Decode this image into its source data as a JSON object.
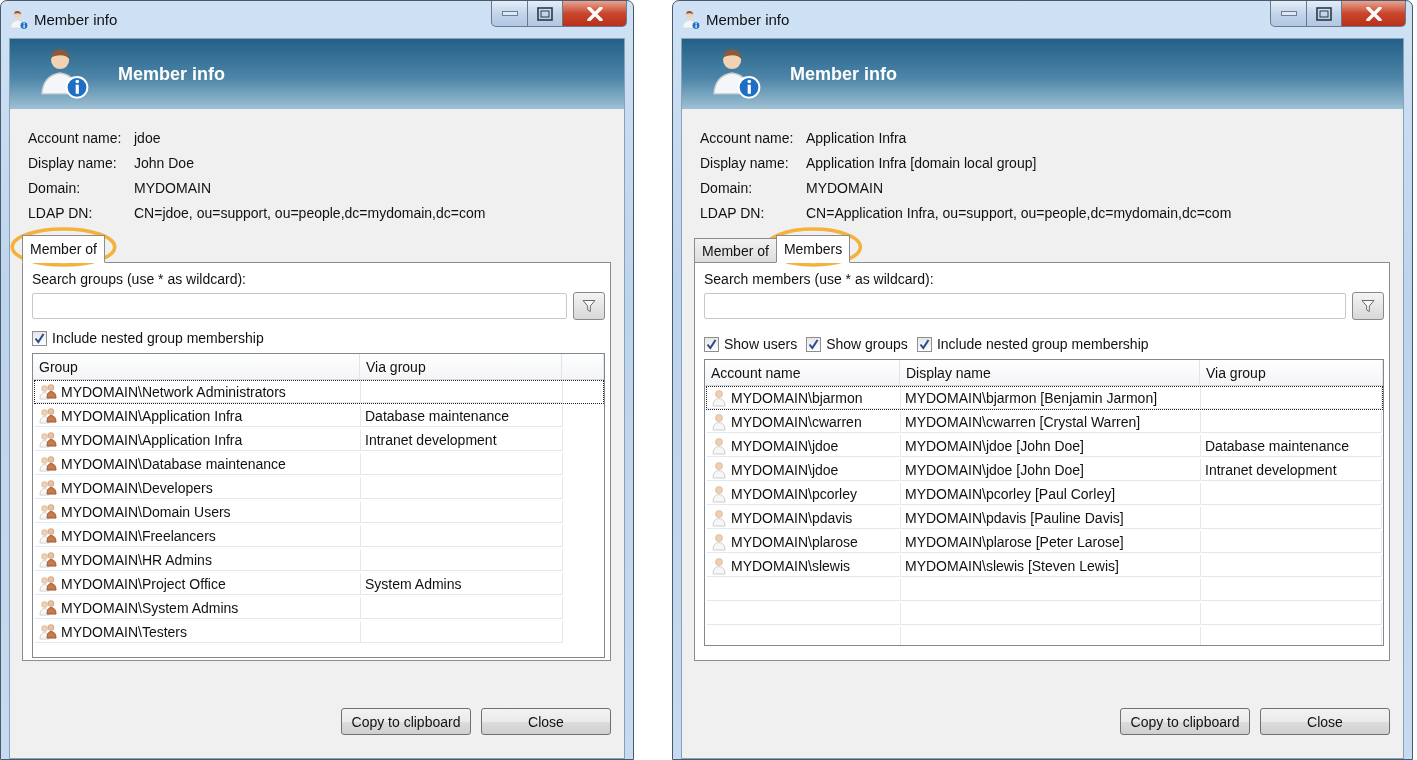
{
  "windows": [
    {
      "title": "Member info",
      "header_title": "Member info",
      "info": [
        {
          "label": "Account name:",
          "value": "jdoe"
        },
        {
          "label": "Display name:",
          "value": "John Doe"
        },
        {
          "label": "Domain:",
          "value": "MYDOMAIN"
        },
        {
          "label": "LDAP DN:",
          "value": "CN=jdoe, ou=support, ou=people,dc=mydomain,dc=com"
        }
      ],
      "tabs": [
        {
          "label": "Member of",
          "selected": true,
          "highlighted": true
        }
      ],
      "search": {
        "label": "Search groups (use * as wildcard):"
      },
      "checkboxes": [
        {
          "label": "Include nested group membership",
          "checked": true
        }
      ],
      "table": {
        "columns": [
          "Group",
          "Via group"
        ],
        "rows": [
          {
            "kind": "group",
            "focused": true,
            "cells": [
              "MYDOMAIN\\Network Administrators",
              ""
            ]
          },
          {
            "kind": "group",
            "focused": false,
            "cells": [
              "MYDOMAIN\\Application Infra",
              "Database maintenance"
            ]
          },
          {
            "kind": "group",
            "focused": false,
            "cells": [
              "MYDOMAIN\\Application Infra",
              "Intranet development"
            ]
          },
          {
            "kind": "group",
            "focused": false,
            "cells": [
              "MYDOMAIN\\Database maintenance",
              ""
            ]
          },
          {
            "kind": "group",
            "focused": false,
            "cells": [
              "MYDOMAIN\\Developers",
              ""
            ]
          },
          {
            "kind": "group",
            "focused": false,
            "cells": [
              "MYDOMAIN\\Domain Users",
              ""
            ]
          },
          {
            "kind": "group",
            "focused": false,
            "cells": [
              "MYDOMAIN\\Freelancers",
              ""
            ]
          },
          {
            "kind": "group",
            "focused": false,
            "cells": [
              "MYDOMAIN\\HR Admins",
              ""
            ]
          },
          {
            "kind": "group",
            "focused": false,
            "cells": [
              "MYDOMAIN\\Project Office",
              "System Admins"
            ]
          },
          {
            "kind": "group",
            "focused": false,
            "cells": [
              "MYDOMAIN\\System Admins",
              ""
            ]
          },
          {
            "kind": "group",
            "focused": false,
            "cells": [
              "MYDOMAIN\\Testers",
              ""
            ]
          }
        ]
      },
      "buttons": [
        "Copy to clipboard",
        "Close"
      ]
    },
    {
      "title": "Member info",
      "header_title": "Member info",
      "info": [
        {
          "label": "Account name:",
          "value": "Application Infra"
        },
        {
          "label": "Display name:",
          "value": "Application Infra [domain local group]"
        },
        {
          "label": "Domain:",
          "value": "MYDOMAIN"
        },
        {
          "label": "LDAP DN:",
          "value": "CN=Application Infra, ou=support, ou=people,dc=mydomain,dc=com"
        }
      ],
      "tabs": [
        {
          "label": "Member of",
          "selected": false,
          "highlighted": false
        },
        {
          "label": "Members",
          "selected": true,
          "highlighted": true
        }
      ],
      "search": {
        "label": "Search members (use * as wildcard):"
      },
      "checkboxes": [
        {
          "label": "Show users",
          "checked": true
        },
        {
          "label": "Show groups",
          "checked": true
        },
        {
          "label": "Include nested group membership",
          "checked": true
        }
      ],
      "table": {
        "columns": [
          "Account name",
          "Display name",
          "Via group"
        ],
        "rows": [
          {
            "kind": "user",
            "focused": true,
            "cells": [
              "MYDOMAIN\\bjarmon",
              "MYDOMAIN\\bjarmon [Benjamin Jarmon]",
              ""
            ]
          },
          {
            "kind": "user",
            "focused": false,
            "cells": [
              "MYDOMAIN\\cwarren",
              "MYDOMAIN\\cwarren [Crystal Warren]",
              ""
            ]
          },
          {
            "kind": "user",
            "focused": false,
            "cells": [
              "MYDOMAIN\\jdoe",
              "MYDOMAIN\\jdoe [John Doe]",
              "Database maintenance"
            ]
          },
          {
            "kind": "user",
            "focused": false,
            "cells": [
              "MYDOMAIN\\jdoe",
              "MYDOMAIN\\jdoe [John Doe]",
              "Intranet development"
            ]
          },
          {
            "kind": "user",
            "focused": false,
            "cells": [
              "MYDOMAIN\\pcorley",
              "MYDOMAIN\\pcorley [Paul Corley]",
              ""
            ]
          },
          {
            "kind": "user",
            "focused": false,
            "cells": [
              "MYDOMAIN\\pdavis",
              "MYDOMAIN\\pdavis  [Pauline Davis]",
              ""
            ]
          },
          {
            "kind": "user",
            "focused": false,
            "cells": [
              "MYDOMAIN\\plarose",
              "MYDOMAIN\\plarose [Peter Larose]",
              ""
            ]
          },
          {
            "kind": "user",
            "focused": false,
            "cells": [
              "MYDOMAIN\\slewis",
              "MYDOMAIN\\slewis [Steven Lewis]",
              ""
            ]
          }
        ]
      },
      "buttons": [
        "Copy to clipboard",
        "Close"
      ]
    }
  ]
}
